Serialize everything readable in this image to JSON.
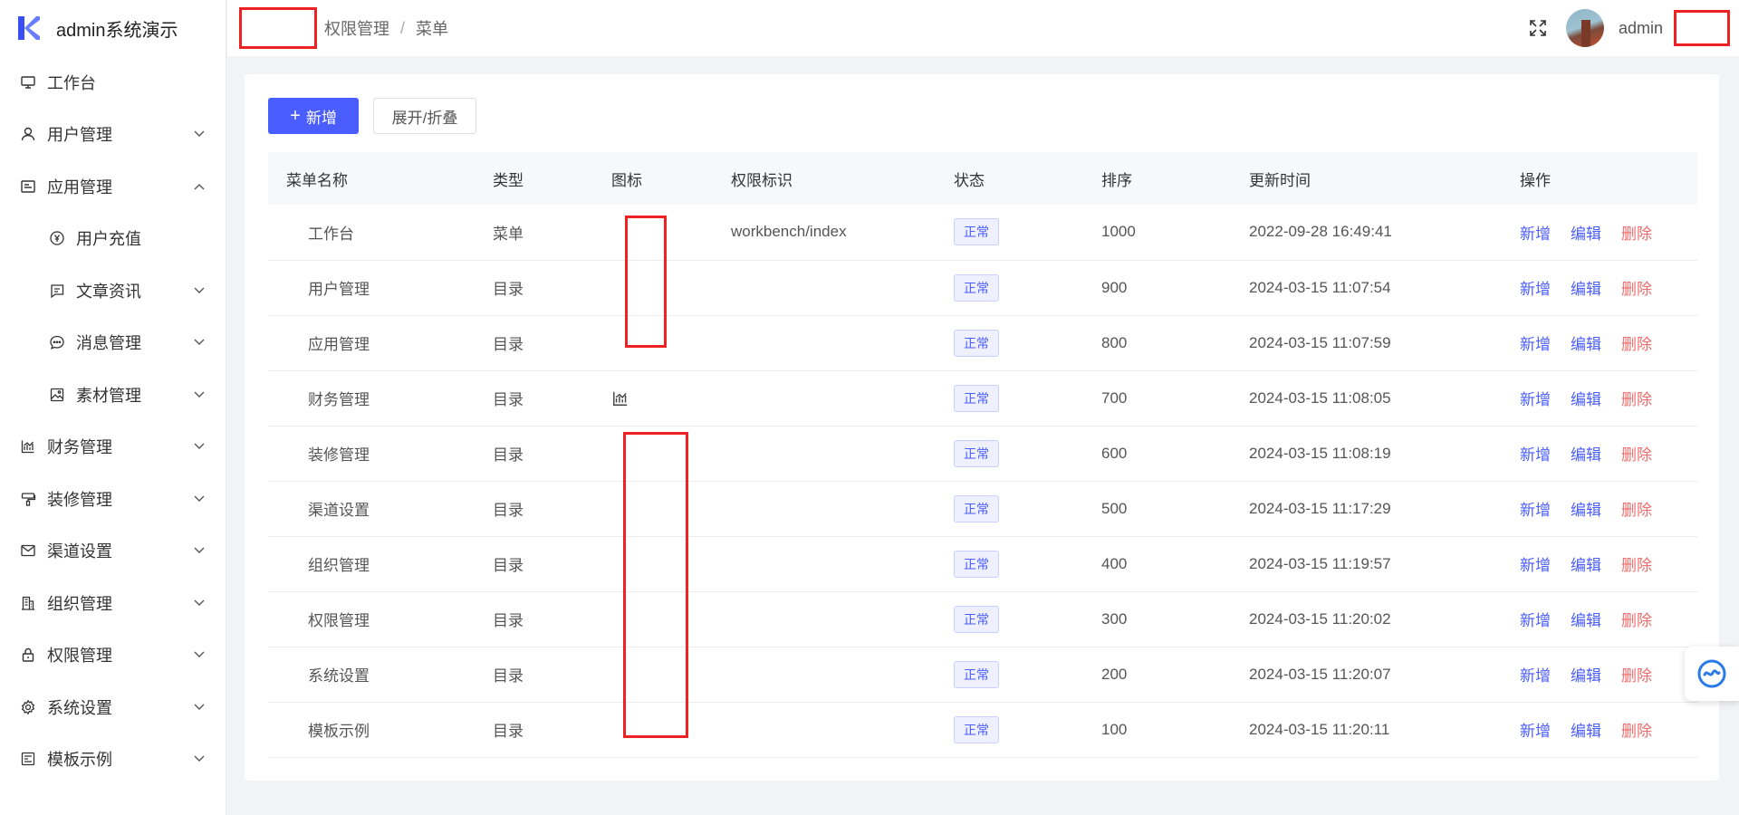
{
  "brand": {
    "title": "admin系统演示"
  },
  "sidebar": {
    "items": [
      {
        "label": "工作台",
        "icon": "monitor-icon"
      },
      {
        "label": "用户管理",
        "icon": "user-icon"
      },
      {
        "label": "应用管理",
        "icon": "app-icon"
      },
      {
        "label": "用户充值",
        "icon": "yen-circle-icon"
      },
      {
        "label": "文章资讯",
        "icon": "message-square-icon"
      },
      {
        "label": "消息管理",
        "icon": "chat-bubble-icon"
      },
      {
        "label": "素材管理",
        "icon": "image-icon"
      },
      {
        "label": "财务管理",
        "icon": "chart-icon"
      },
      {
        "label": "装修管理",
        "icon": "paint-icon"
      },
      {
        "label": "渠道设置",
        "icon": "mail-icon"
      },
      {
        "label": "组织管理",
        "icon": "building-icon"
      },
      {
        "label": "权限管理",
        "icon": "lock-icon"
      },
      {
        "label": "系统设置",
        "icon": "gear-icon"
      },
      {
        "label": "模板示例",
        "icon": "template-icon"
      }
    ]
  },
  "header": {
    "breadcrumb": [
      "权限管理",
      "菜单"
    ],
    "breadcrumb_sep": "/",
    "username": "admin"
  },
  "toolbar": {
    "add_label": "新增",
    "add_icon": "+",
    "expand_label": "展开/折叠"
  },
  "table": {
    "columns": [
      "菜单名称",
      "类型",
      "图标",
      "权限标识",
      "状态",
      "排序",
      "更新时间",
      "操作"
    ],
    "rows": [
      {
        "name": "工作台",
        "type": "菜单",
        "perm": "workbench/index",
        "status": "正常",
        "sort": "1000",
        "time": "2022-09-28 16:49:41"
      },
      {
        "name": "用户管理",
        "type": "目录",
        "perm": "",
        "status": "正常",
        "sort": "900",
        "time": "2024-03-15 11:07:54"
      },
      {
        "name": "应用管理",
        "type": "目录",
        "perm": "",
        "status": "正常",
        "sort": "800",
        "time": "2024-03-15 11:07:59"
      },
      {
        "name": "财务管理",
        "type": "目录",
        "perm": "",
        "status": "正常",
        "sort": "700",
        "time": "2024-03-15 11:08:05"
      },
      {
        "name": "装修管理",
        "type": "目录",
        "perm": "",
        "status": "正常",
        "sort": "600",
        "time": "2024-03-15 11:08:19"
      },
      {
        "name": "渠道设置",
        "type": "目录",
        "perm": "",
        "status": "正常",
        "sort": "500",
        "time": "2024-03-15 11:17:29"
      },
      {
        "name": "组织管理",
        "type": "目录",
        "perm": "",
        "status": "正常",
        "sort": "400",
        "time": "2024-03-15 11:19:57"
      },
      {
        "name": "权限管理",
        "type": "目录",
        "perm": "",
        "status": "正常",
        "sort": "300",
        "time": "2024-03-15 11:20:02"
      },
      {
        "name": "系统设置",
        "type": "目录",
        "perm": "",
        "status": "正常",
        "sort": "200",
        "time": "2024-03-15 11:20:07"
      },
      {
        "name": "模板示例",
        "type": "目录",
        "perm": "",
        "status": "正常",
        "sort": "100",
        "time": "2024-03-15 11:20:11"
      }
    ],
    "actions": {
      "add": "新增",
      "edit": "编辑",
      "delete": "删除"
    }
  },
  "colors": {
    "primary": "#4a5dff",
    "danger": "#f06b6b",
    "highlight_box": "#ee2222"
  }
}
